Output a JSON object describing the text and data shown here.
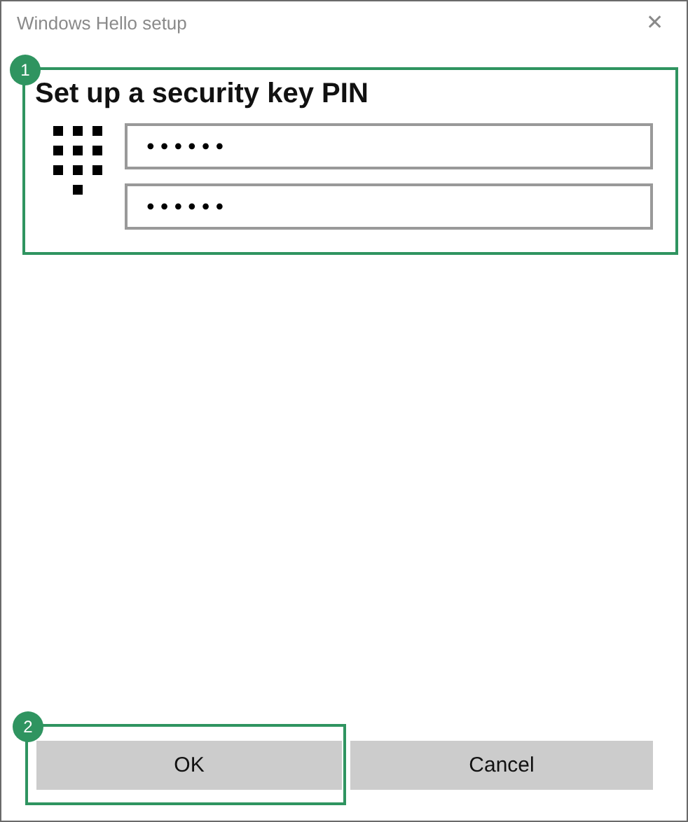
{
  "window": {
    "title": "Windows Hello setup",
    "close": "✕"
  },
  "pin_section": {
    "callout": "1",
    "heading": "Set up a security key PIN",
    "fields": [
      {
        "value": "••••••"
      },
      {
        "value": "••••••"
      }
    ]
  },
  "buttons": [
    {
      "label": "OK",
      "callout": "2"
    },
    {
      "label": "Cancel"
    }
  ]
}
